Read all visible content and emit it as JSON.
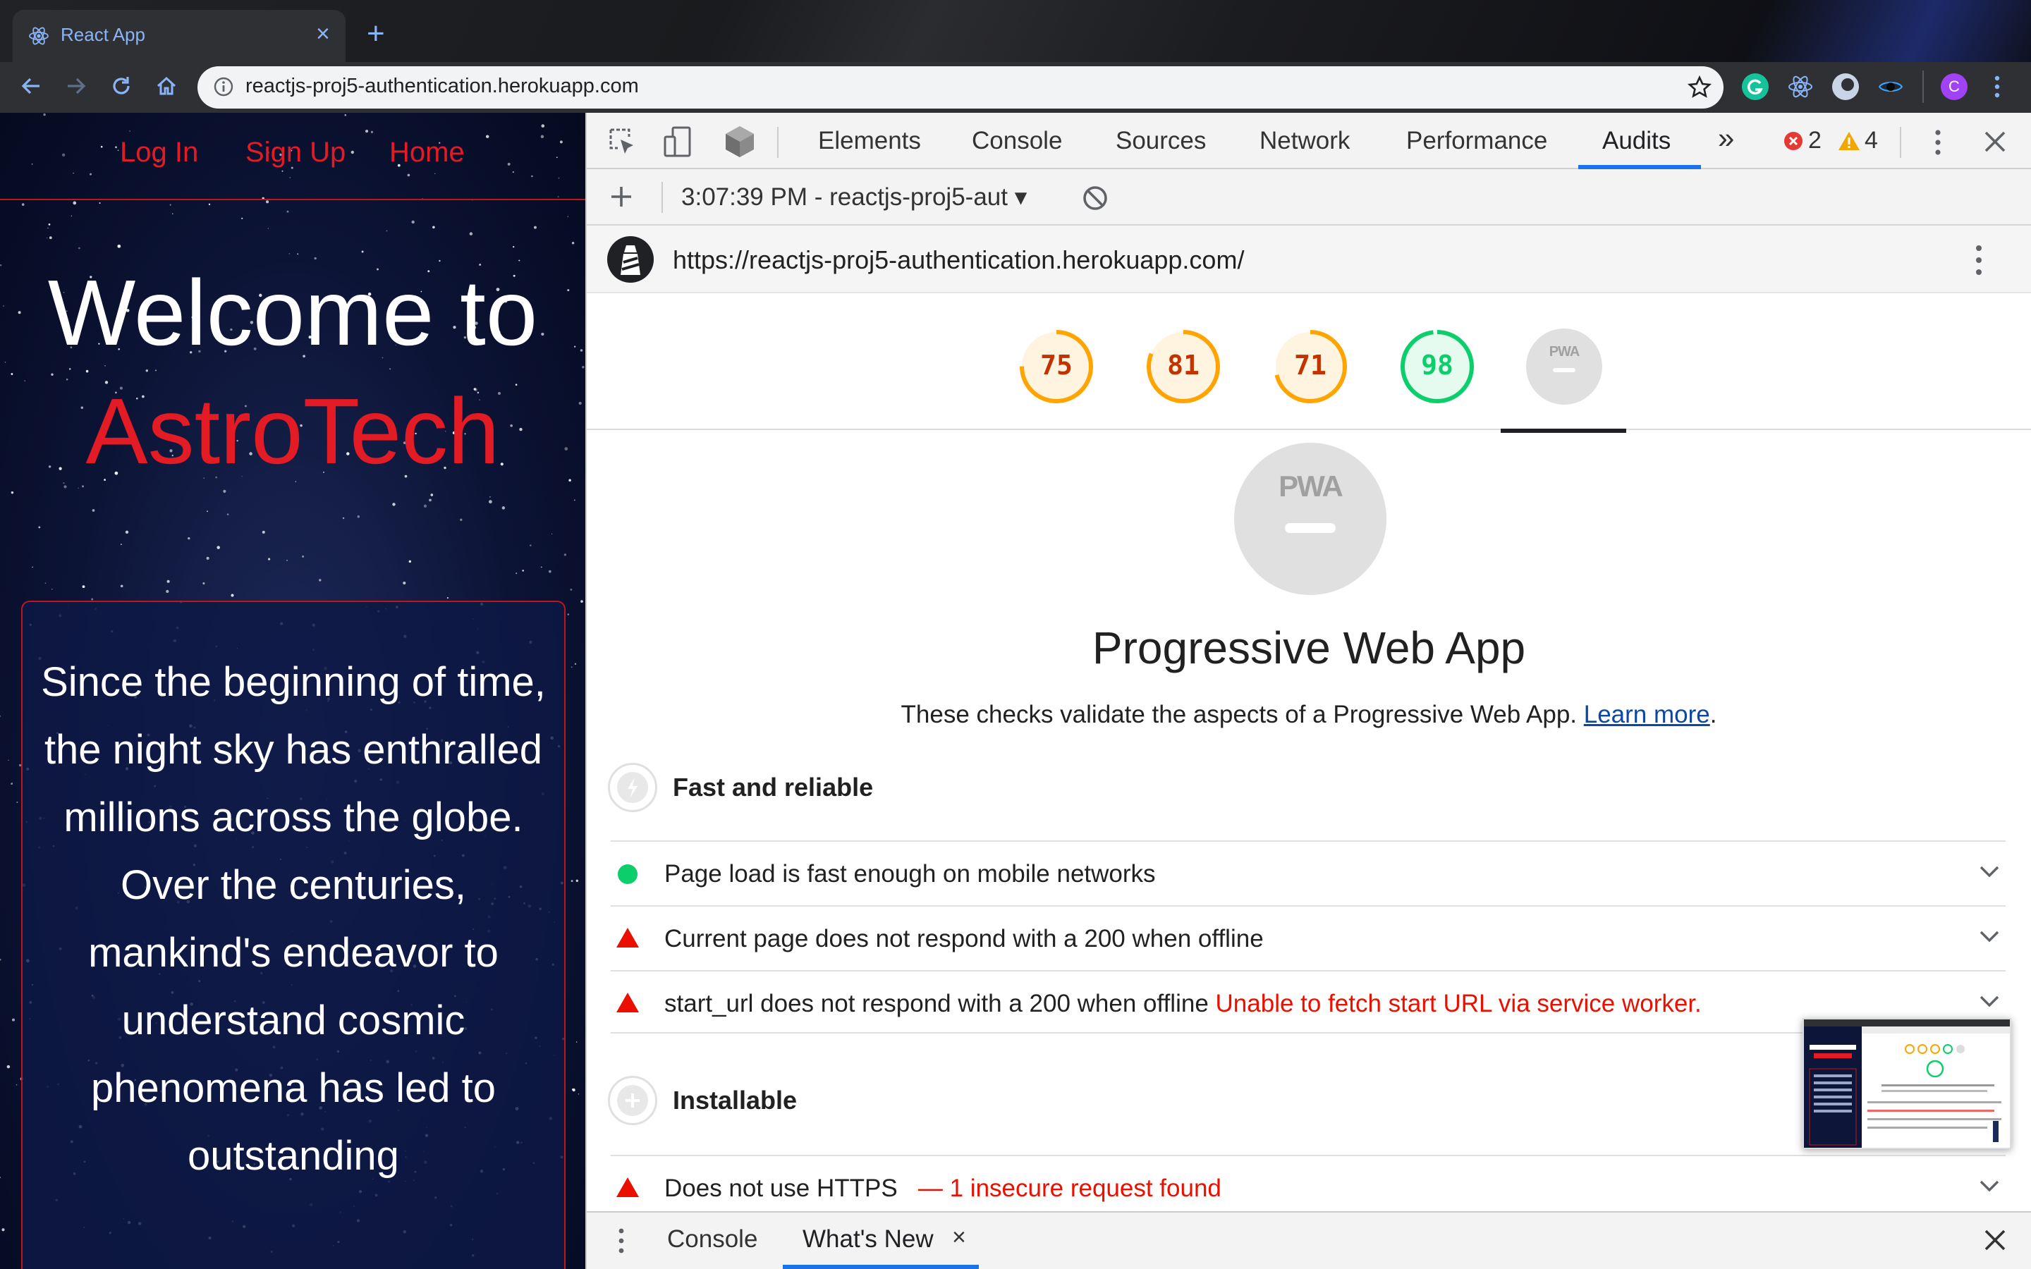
{
  "browser": {
    "tab_title": "React App",
    "tab_close": "×",
    "new_tab": "+",
    "url": "reactjs-proj5-authentication.herokuapp.com",
    "extension_avatar_letter": "C"
  },
  "site": {
    "nav": [
      "Log In",
      "Sign Up",
      "Home"
    ],
    "welcome_line1": "Welcome to",
    "welcome_line2": "AstroTech",
    "intro_text": "Since the beginning of time, the night sky has enthralled millions across the globe. Over the centuries, mankind's endeavor to understand cosmic phenomena has led to outstanding"
  },
  "devtools": {
    "tabs": [
      "Elements",
      "Console",
      "Sources",
      "Network",
      "Performance",
      "Audits"
    ],
    "active_tab": "Audits",
    "more_tabs": "»",
    "error_count": "2",
    "warning_count": "4",
    "report_selector": "3:07:39 PM - reactjs-proj5-aut ▾",
    "report_url": "https://reactjs-proj5-authentication.herokuapp.com/",
    "scores": [
      {
        "value": "75",
        "color": "#ffa400"
      },
      {
        "value": "81",
        "color": "#ffa400"
      },
      {
        "value": "71",
        "color": "#ffa400"
      },
      {
        "value": "98",
        "color": "#0cce6b"
      }
    ],
    "pwa_badge": "PWA",
    "pwa_title": "Progressive Web App",
    "pwa_description": "These checks validate the aspects of a Progressive Web App.",
    "learn_more": "Learn more",
    "period": ".",
    "groups": {
      "fast": "Fast and reliable",
      "installable": "Installable"
    },
    "audits": {
      "a1": {
        "title": "Page load is fast enough on mobile networks",
        "status": "pass"
      },
      "a2": {
        "title": "Current page does not respond with a 200 when offline",
        "status": "fail"
      },
      "a3": {
        "title": "start_url does not respond with a 200 when offline",
        "error": "Unable to fetch start URL via service worker.",
        "status": "fail"
      },
      "a4": {
        "title": "Does not use HTTPS",
        "error": "— 1 insecure request found",
        "status": "fail"
      }
    },
    "drawer_tabs": [
      "Console",
      "What's New"
    ],
    "drawer_close": "×"
  },
  "colors": {
    "accent_blue": "#1a73e8",
    "site_red": "#e21b25",
    "fail_red": "#eb0f00",
    "pass_green": "#0cce6b",
    "average_orange": "#ffa400"
  }
}
